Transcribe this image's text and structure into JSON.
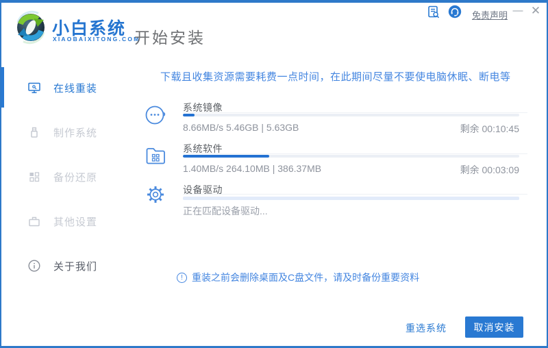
{
  "colors": {
    "accent": "#2979d2",
    "frame_border": "#2e79c9",
    "notice_blue": "#4486e0",
    "progress_fill": "#2472d2"
  },
  "header": {
    "brand": {
      "name": "小白系统",
      "domain": "XIAOBAIXITONG.COM",
      "logo_icon": "sync-arrows-logo"
    },
    "title": "开始安装",
    "controls": {
      "icons": [
        "doc-search-icon",
        "headset-service-icon"
      ],
      "disclaimer_link": "免责声明",
      "minimize": "—",
      "close": "✕"
    }
  },
  "sidebar": {
    "items": [
      {
        "label": "在线重装",
        "icon": "monitor-icon",
        "active": true
      },
      {
        "label": "制作系统",
        "icon": "usb-drive-icon",
        "active": false
      },
      {
        "label": "备份还原",
        "icon": "backup-squares-icon",
        "active": false
      },
      {
        "label": "其他设置",
        "icon": "toolbox-icon",
        "active": false
      },
      {
        "label": "关于我们",
        "icon": "info-circle-icon",
        "active": false
      }
    ]
  },
  "main": {
    "notice": "下载且收集资源需要耗费一点时间，在此期间尽量不要使电脑休眠、断电等",
    "tasks": [
      {
        "name": "系统镜像",
        "icon": "chat-face-icon",
        "progress_percent": 3.5,
        "stats": "8.66MB/s 5.46GB | 5.63GB",
        "remaining": "剩余 00:10:45"
      },
      {
        "name": "系统软件",
        "icon": "folder-apps-icon",
        "progress_percent": 25.6,
        "stats": "1.40MB/s 264.10MB | 386.37MB",
        "remaining": "剩余 00:03:09"
      },
      {
        "name": "设备驱动",
        "icon": "gear-icon",
        "progress_percent": 0,
        "stats": "正在匹配设备驱动...",
        "remaining": ""
      }
    ],
    "warning": "重装之前会删除桌面及C盘文件，请及时备份重要资料",
    "warning_icon": "exclamation-circle-icon"
  },
  "footer": {
    "reselect_label": "重选系统",
    "cancel_label": "取消安装"
  }
}
